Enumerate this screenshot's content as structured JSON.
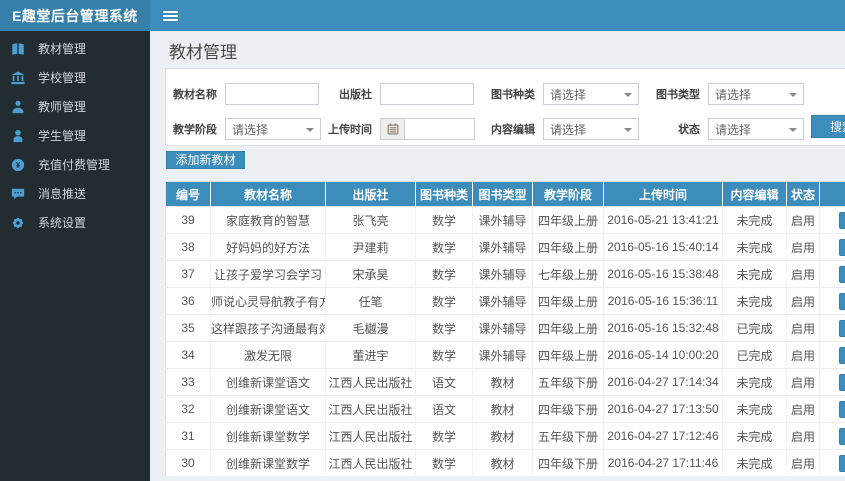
{
  "app": {
    "title": "E趣堂后台管理系统"
  },
  "navbar": {
    "hamburger_icon": "hamburger-menu-icon"
  },
  "sidebar": {
    "items": [
      {
        "key": "textbooks",
        "icon": "book-icon",
        "label": "教材管理"
      },
      {
        "key": "schools",
        "icon": "university-icon",
        "label": "学校管理"
      },
      {
        "key": "teachers",
        "icon": "teacher-icon",
        "label": "教师管理"
      },
      {
        "key": "students",
        "icon": "student-icon",
        "label": "学生管理"
      },
      {
        "key": "payments",
        "icon": "payment-icon",
        "label": "充值付费管理"
      },
      {
        "key": "messages",
        "icon": "message-icon",
        "label": "消息推送"
      },
      {
        "key": "settings",
        "icon": "settings-icon",
        "label": "系统设置"
      }
    ]
  },
  "page": {
    "title": "教材管理"
  },
  "filters": {
    "fields": [
      {
        "name": "textbook-name",
        "label": "教材名称",
        "type": "text",
        "value": "",
        "placeholder": ""
      },
      {
        "name": "publisher",
        "label": "出版社",
        "type": "text",
        "value": "",
        "placeholder": ""
      },
      {
        "name": "book-category",
        "label": "图书种类",
        "type": "select",
        "value": "请选择"
      },
      {
        "name": "book-type",
        "label": "图书类型",
        "type": "select",
        "value": "请选择"
      },
      {
        "name": "teaching-stage",
        "label": "教学阶段",
        "type": "select",
        "value": "请选择"
      },
      {
        "name": "upload-time",
        "label": "上传时间",
        "type": "date",
        "value": "",
        "placeholder": ""
      },
      {
        "name": "content-edit",
        "label": "内容编辑",
        "type": "select",
        "value": "请选择"
      },
      {
        "name": "status",
        "label": "状态",
        "type": "select",
        "value": "请选择"
      }
    ],
    "search_label": "搜索"
  },
  "actions": {
    "add_label": "添加新教材"
  },
  "table": {
    "headers": [
      "编号",
      "教材名称",
      "出版社",
      "图书种类",
      "图书类型",
      "教学阶段",
      "上传时间",
      "内容编辑",
      "状态"
    ],
    "rows": [
      [
        "39",
        "家庭教育的智慧",
        "张飞亮",
        "数学",
        "课外辅导",
        "四年级上册",
        "2016-05-21 13:41:21",
        "未完成",
        "启用"
      ],
      [
        "38",
        "好妈妈的好方法",
        "尹建莉",
        "数学",
        "课外辅导",
        "四年级上册",
        "2016-05-16 15:40:14",
        "未完成",
        "启用"
      ],
      [
        "37",
        "让孩子爱学习会学习",
        "宋承昊",
        "数学",
        "课外辅导",
        "七年级上册",
        "2016-05-16 15:38:48",
        "未完成",
        "启用"
      ],
      [
        "36",
        "师说心灵导航教子有方",
        "任笔",
        "数学",
        "课外辅导",
        "四年级上册",
        "2016-05-16 15:36:11",
        "未完成",
        "启用"
      ],
      [
        "35",
        "这样跟孩子沟通最有效",
        "毛樾漫",
        "数学",
        "课外辅导",
        "四年级上册",
        "2016-05-16 15:32:48",
        "已完成",
        "启用"
      ],
      [
        "34",
        "激发无限",
        "董进宇",
        "数学",
        "课外辅导",
        "四年级上册",
        "2016-05-14 10:00:20",
        "已完成",
        "启用"
      ],
      [
        "33",
        "创维新课堂语文",
        "江西人民出版社",
        "语文",
        "教材",
        "五年级下册",
        "2016-04-27 17:14:34",
        "未完成",
        "启用"
      ],
      [
        "32",
        "创维新课堂语文",
        "江西人民出版社",
        "语文",
        "教材",
        "四年级下册",
        "2016-04-27 17:13:50",
        "未完成",
        "启用"
      ],
      [
        "31",
        "创维新课堂数学",
        "江西人民出版社",
        "数学",
        "教材",
        "五年级下册",
        "2016-04-27 17:12:46",
        "未完成",
        "启用"
      ],
      [
        "30",
        "创维新课堂数学",
        "江西人民出版社",
        "数学",
        "教材",
        "四年级下册",
        "2016-04-27 17:11:46",
        "未完成",
        "启用"
      ]
    ]
  },
  "colors": {
    "navbar_bg": "#3c8dbc",
    "logo_bg": "#367fa9",
    "sidebar_bg": "#222d32",
    "sidebar_icon": "#4b9fd2",
    "content_bg": "#ecf0f5",
    "table_header_bg": "#3c8dbc",
    "button_bg": "#3c8dbc"
  }
}
